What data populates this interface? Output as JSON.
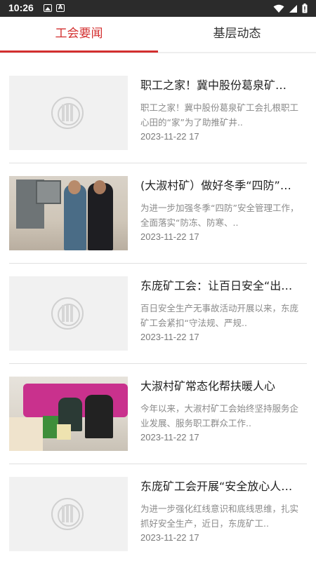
{
  "status_bar": {
    "time": "10:26",
    "left_icons": [
      "image-notification-icon",
      "a-notification-icon"
    ],
    "right_icons": [
      "wifi-icon",
      "cell-signal-icon",
      "battery-icon"
    ]
  },
  "tabs": [
    {
      "label": "工会要闻",
      "active": true
    },
    {
      "label": "基层动态",
      "active": false
    }
  ],
  "accent_color": "#d32f2f",
  "articles": [
    {
      "title": "职工之家！冀中股份葛泉矿…",
      "summary": "职工之家！冀中股份葛泉矿工会扎根职工心田的“家”为了助推矿井..",
      "date": "2023-11-22 17",
      "image": "placeholder-emblem"
    },
    {
      "title": "(大淑村矿）做好冬季“四防”…",
      "summary": "为进一步加强冬季“四防”安全管理工作，全面落实“防冻、防寒、..",
      "date": "2023-11-22 17",
      "image": "photo-inspection"
    },
    {
      "title": "东庞矿工会：让百日安全“出…",
      "summary": "百日安全生产无事故活动开展以来，东庞矿工会紧扣“守法规、严规..",
      "date": "2023-11-22 17",
      "image": "placeholder-emblem"
    },
    {
      "title": "大淑村矿常态化帮扶暖人心",
      "summary": "今年以来，大淑村矿工会始终坚持服务企业发展、服务职工群众工作..",
      "date": "2023-11-22 17",
      "image": "photo-visit"
    },
    {
      "title": "东庞矿工会开展“安全放心人…",
      "summary": "为进一步强化红线意识和底线思维，扎实抓好安全生产，近日，东庞矿工..",
      "date": "2023-11-22 17",
      "image": "placeholder-emblem"
    }
  ]
}
